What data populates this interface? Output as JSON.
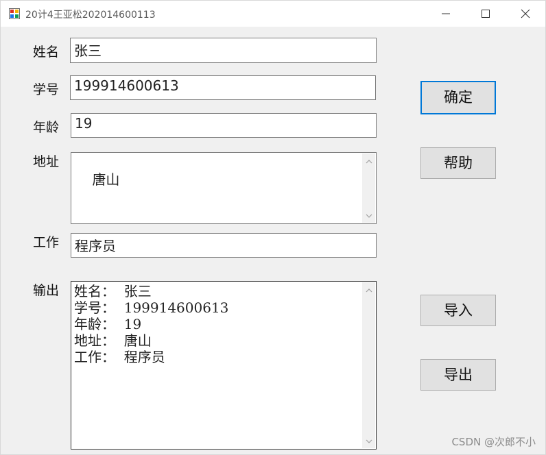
{
  "window": {
    "title": "20计4王亚松202014600113",
    "icon": "form-app-icon",
    "controls": [
      "minimize-icon",
      "maximize-icon",
      "close-icon"
    ]
  },
  "form": {
    "name_label": "姓名",
    "name_value": "张三",
    "id_label": "学号",
    "id_value": "199914600613",
    "age_label": "年龄",
    "age_value": "19",
    "address_label": "地址",
    "address_value": "唐山",
    "job_label": "工作",
    "job_value": "程序员",
    "output_label": "输出",
    "output_value": "姓名：  张三\n学号：  199914600613\n年龄：  19\n地址：  唐山\n工作：  程序员"
  },
  "buttons": {
    "confirm": "确定",
    "help": "帮助",
    "import": "导入",
    "export": "导出"
  },
  "watermark": "CSDN @次郎不小",
  "colors": {
    "focus_border": "#0078d7",
    "button_face": "#e1e1e1",
    "window_bg": "#f0f0f0"
  }
}
